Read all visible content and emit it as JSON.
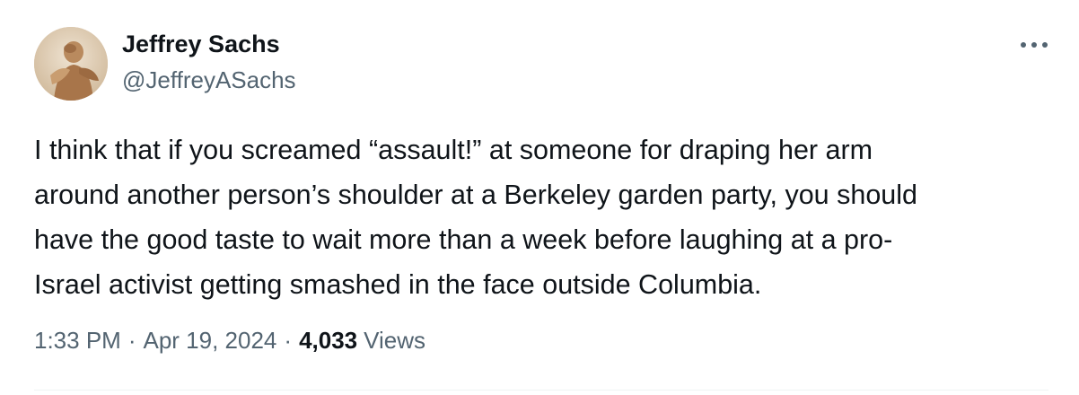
{
  "author": {
    "name": "Jeffrey Sachs",
    "handle": "@JeffreyASachs",
    "avatar_icon": "profile-photo-avatar"
  },
  "tweet": {
    "text": "I think that if you screamed “assault!” at someone for draping her arm\naround another person’s shoulder at a Berkeley garden party, you should\nhave the good taste to wait more than a week before laughing at a pro-\nIsrael activist getting smashed in the face outside Columbia.",
    "time": "1:33 PM",
    "date": "Apr 19, 2024",
    "separator": "·",
    "views_count": "4,033",
    "views_label": "Views"
  },
  "menu": {
    "more_icon": "more-horizontal-icon"
  },
  "colors": {
    "text_primary": "#0f1419",
    "text_secondary": "#536471",
    "divider": "#eff3f4"
  }
}
